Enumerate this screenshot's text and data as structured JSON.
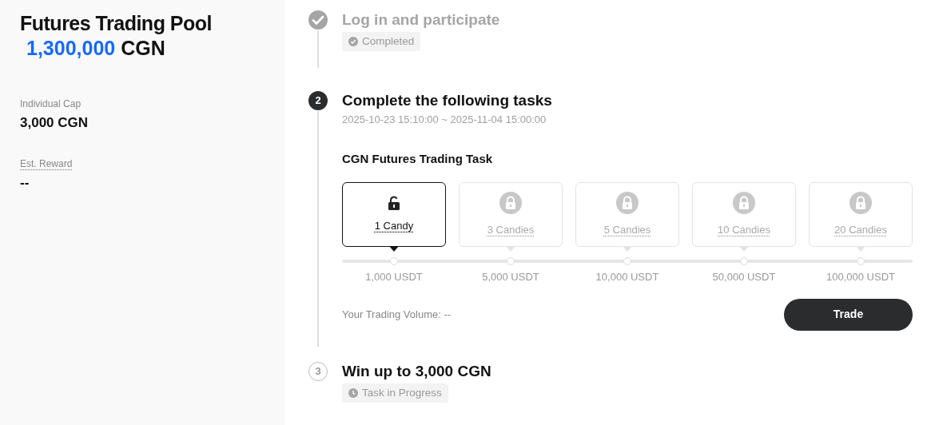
{
  "pool": {
    "title": "Futures Trading Pool",
    "amount": "1,300,000",
    "unit": "CGN",
    "stats": [
      {
        "label": "Individual Cap",
        "value": "3,000 CGN",
        "dotted": false
      },
      {
        "label": "Est. Reward",
        "value": "--",
        "dotted": true
      }
    ]
  },
  "steps": [
    {
      "kind": "completed",
      "title": "Log in and participate",
      "status": {
        "kind": "done",
        "label": "Completed"
      }
    },
    {
      "kind": "active",
      "marker": "2",
      "title": "Complete the following tasks",
      "period": "2025-10-23 15:10:00 ~ 2025-11-04 15:00:00",
      "task": {
        "title": "CGN Futures Trading Task",
        "tiers": [
          {
            "reward": "1 Candy",
            "threshold": "1,000 USDT",
            "unlocked": true,
            "selected": true
          },
          {
            "reward": "3 Candies",
            "threshold": "5,000 USDT",
            "unlocked": false,
            "selected": false
          },
          {
            "reward": "5 Candies",
            "threshold": "10,000 USDT",
            "unlocked": false,
            "selected": false
          },
          {
            "reward": "10 Candies",
            "threshold": "50,000 USDT",
            "unlocked": false,
            "selected": false
          },
          {
            "reward": "20 Candies",
            "threshold": "100,000 USDT",
            "unlocked": false,
            "selected": false
          }
        ],
        "volume": "Your Trading Volume: --",
        "button": "Trade"
      }
    },
    {
      "kind": "pending",
      "marker": "3",
      "title": "Win up to 3,000 CGN",
      "status": {
        "kind": "progress",
        "label": "Task in Progress"
      }
    }
  ]
}
